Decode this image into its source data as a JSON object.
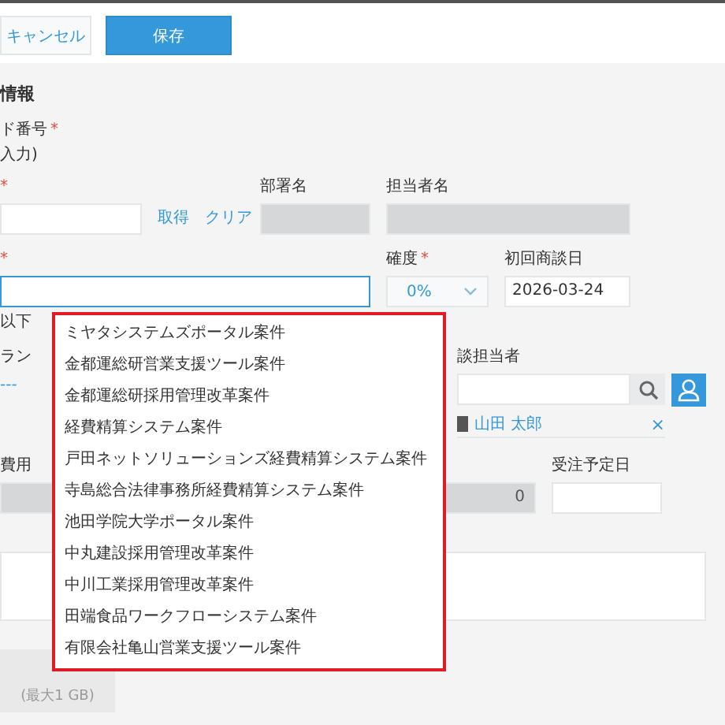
{
  "toolbar": {
    "buttons": [
      {
        "label": "キャンセル",
        "kind": "secondary"
      },
      {
        "label": "保存",
        "kind": "primary"
      }
    ]
  },
  "section": {
    "title": "情報"
  },
  "code_field": {
    "label": "ド番号",
    "required_mark": "*",
    "note": "入力)"
  },
  "customer": {
    "required_mark": "*",
    "links": [
      "取得",
      "クリア"
    ]
  },
  "department": {
    "label": "部署名"
  },
  "staff": {
    "label": "担当者名"
  },
  "project_name": {
    "required_mark": "*",
    "focused": true,
    "hint": "以下"
  },
  "probability": {
    "label": "確度",
    "required_mark": "*",
    "value": "0%"
  },
  "first_meeting_date": {
    "label": "初回商談日",
    "value": "2026-03-24"
  },
  "plan": {
    "label": "ラン",
    "value": "---"
  },
  "sales_rep": {
    "label": "談担当者",
    "assignee": "山田 太郎",
    "remove_icon": "×"
  },
  "cost": {
    "label": "費用",
    "value": "0"
  },
  "order_date": {
    "label": "受注予定日"
  },
  "attachment": {
    "hint": "(最大1 GB)"
  },
  "dropdown": {
    "items": [
      "ミヤタシステムズポータル案件",
      "金都運総研営業支援ツール案件",
      "金都運総研採用管理改革案件",
      "経費精算システム案件",
      "戸田ネットソリューションズ経費精算システム案件",
      "寺島総合法律事務所経費精算システム案件",
      "池田学院大学ポータル案件",
      "中丸建設採用管理改革案件",
      "中川工業採用管理改革案件",
      "田端食品ワークフローシステム案件",
      "有限会社亀山営業支援ツール案件"
    ]
  }
}
